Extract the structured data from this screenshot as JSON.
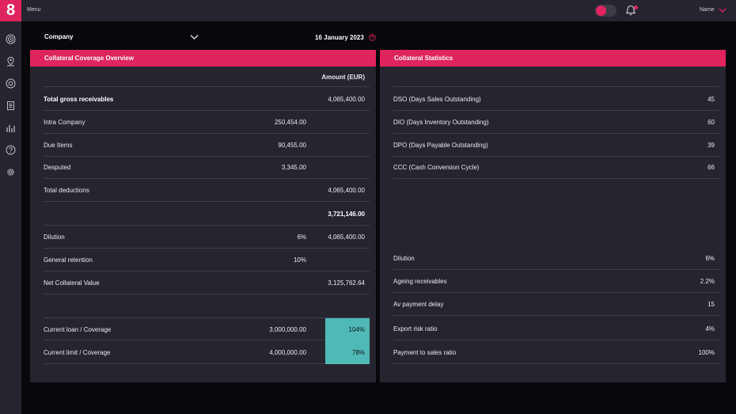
{
  "topbar": {
    "logo": "8",
    "menu_label": "Menu",
    "name_label": "Name"
  },
  "header": {
    "company_label": "Company",
    "date": "16 January 2023"
  },
  "colors": {
    "accent": "#e0245e",
    "panel": "#26252f",
    "highlight_cell": "#4fb9b8"
  },
  "sidebar_icons": [
    "target-icon",
    "location-pin-icon",
    "lifebuoy-icon",
    "documents-icon",
    "bar-chart-icon",
    "help-icon",
    "settings-icon"
  ],
  "coverage": {
    "title": "Collateral Coverage Overview",
    "amount_header": "Amount (EUR)",
    "rows": [
      {
        "label": "Total gross receivables",
        "mid": "",
        "amount": "4,065,400.00"
      },
      {
        "label": "Intra Company",
        "mid": "250,454.00",
        "amount": ""
      },
      {
        "label": "Due Items",
        "mid": "90,455.00",
        "amount": ""
      },
      {
        "label": "Desputed",
        "mid": "3,345.00",
        "amount": ""
      },
      {
        "label": "Total deductions",
        "mid": "",
        "amount": "4,065,400.00"
      },
      {
        "label": "",
        "mid": "",
        "amount": "3,721,146.00"
      },
      {
        "label": "Dilution",
        "mid": "6%",
        "amount": "4,065,400.00"
      },
      {
        "label": "General retention",
        "mid": "10%",
        "amount": ""
      },
      {
        "label": "Net Collateral Value",
        "mid": "",
        "amount": "3,125,762.64"
      }
    ],
    "loan_rows": [
      {
        "label": "Current loan / Coverage",
        "mid": "3,000,000.00",
        "cell": "104%"
      },
      {
        "label": "Current limit / Coverage",
        "mid": "4,000,000.00",
        "cell": "78%"
      }
    ]
  },
  "statistics": {
    "title": "Collateral Statistics",
    "rows_top": [
      {
        "label": "DSO (Days Sales Outstanding)",
        "value": "45"
      },
      {
        "label": "DIO (Days Inventory Outstanding)",
        "value": "60"
      },
      {
        "label": "DPO (Days Payable Outstanding)",
        "value": "39"
      },
      {
        "label": "CCC (Cash Conversion Cycle)",
        "value": "66"
      }
    ],
    "rows_bottom": [
      {
        "label": "Dilution",
        "value": "6%"
      },
      {
        "label": "Ageing receivables",
        "value": "2.2%"
      },
      {
        "label": "Av payment delay",
        "value": "15"
      },
      {
        "label": "Export risk ratio",
        "value": "4%"
      },
      {
        "label": "Payment to sales ratio",
        "value": "100%"
      }
    ]
  }
}
